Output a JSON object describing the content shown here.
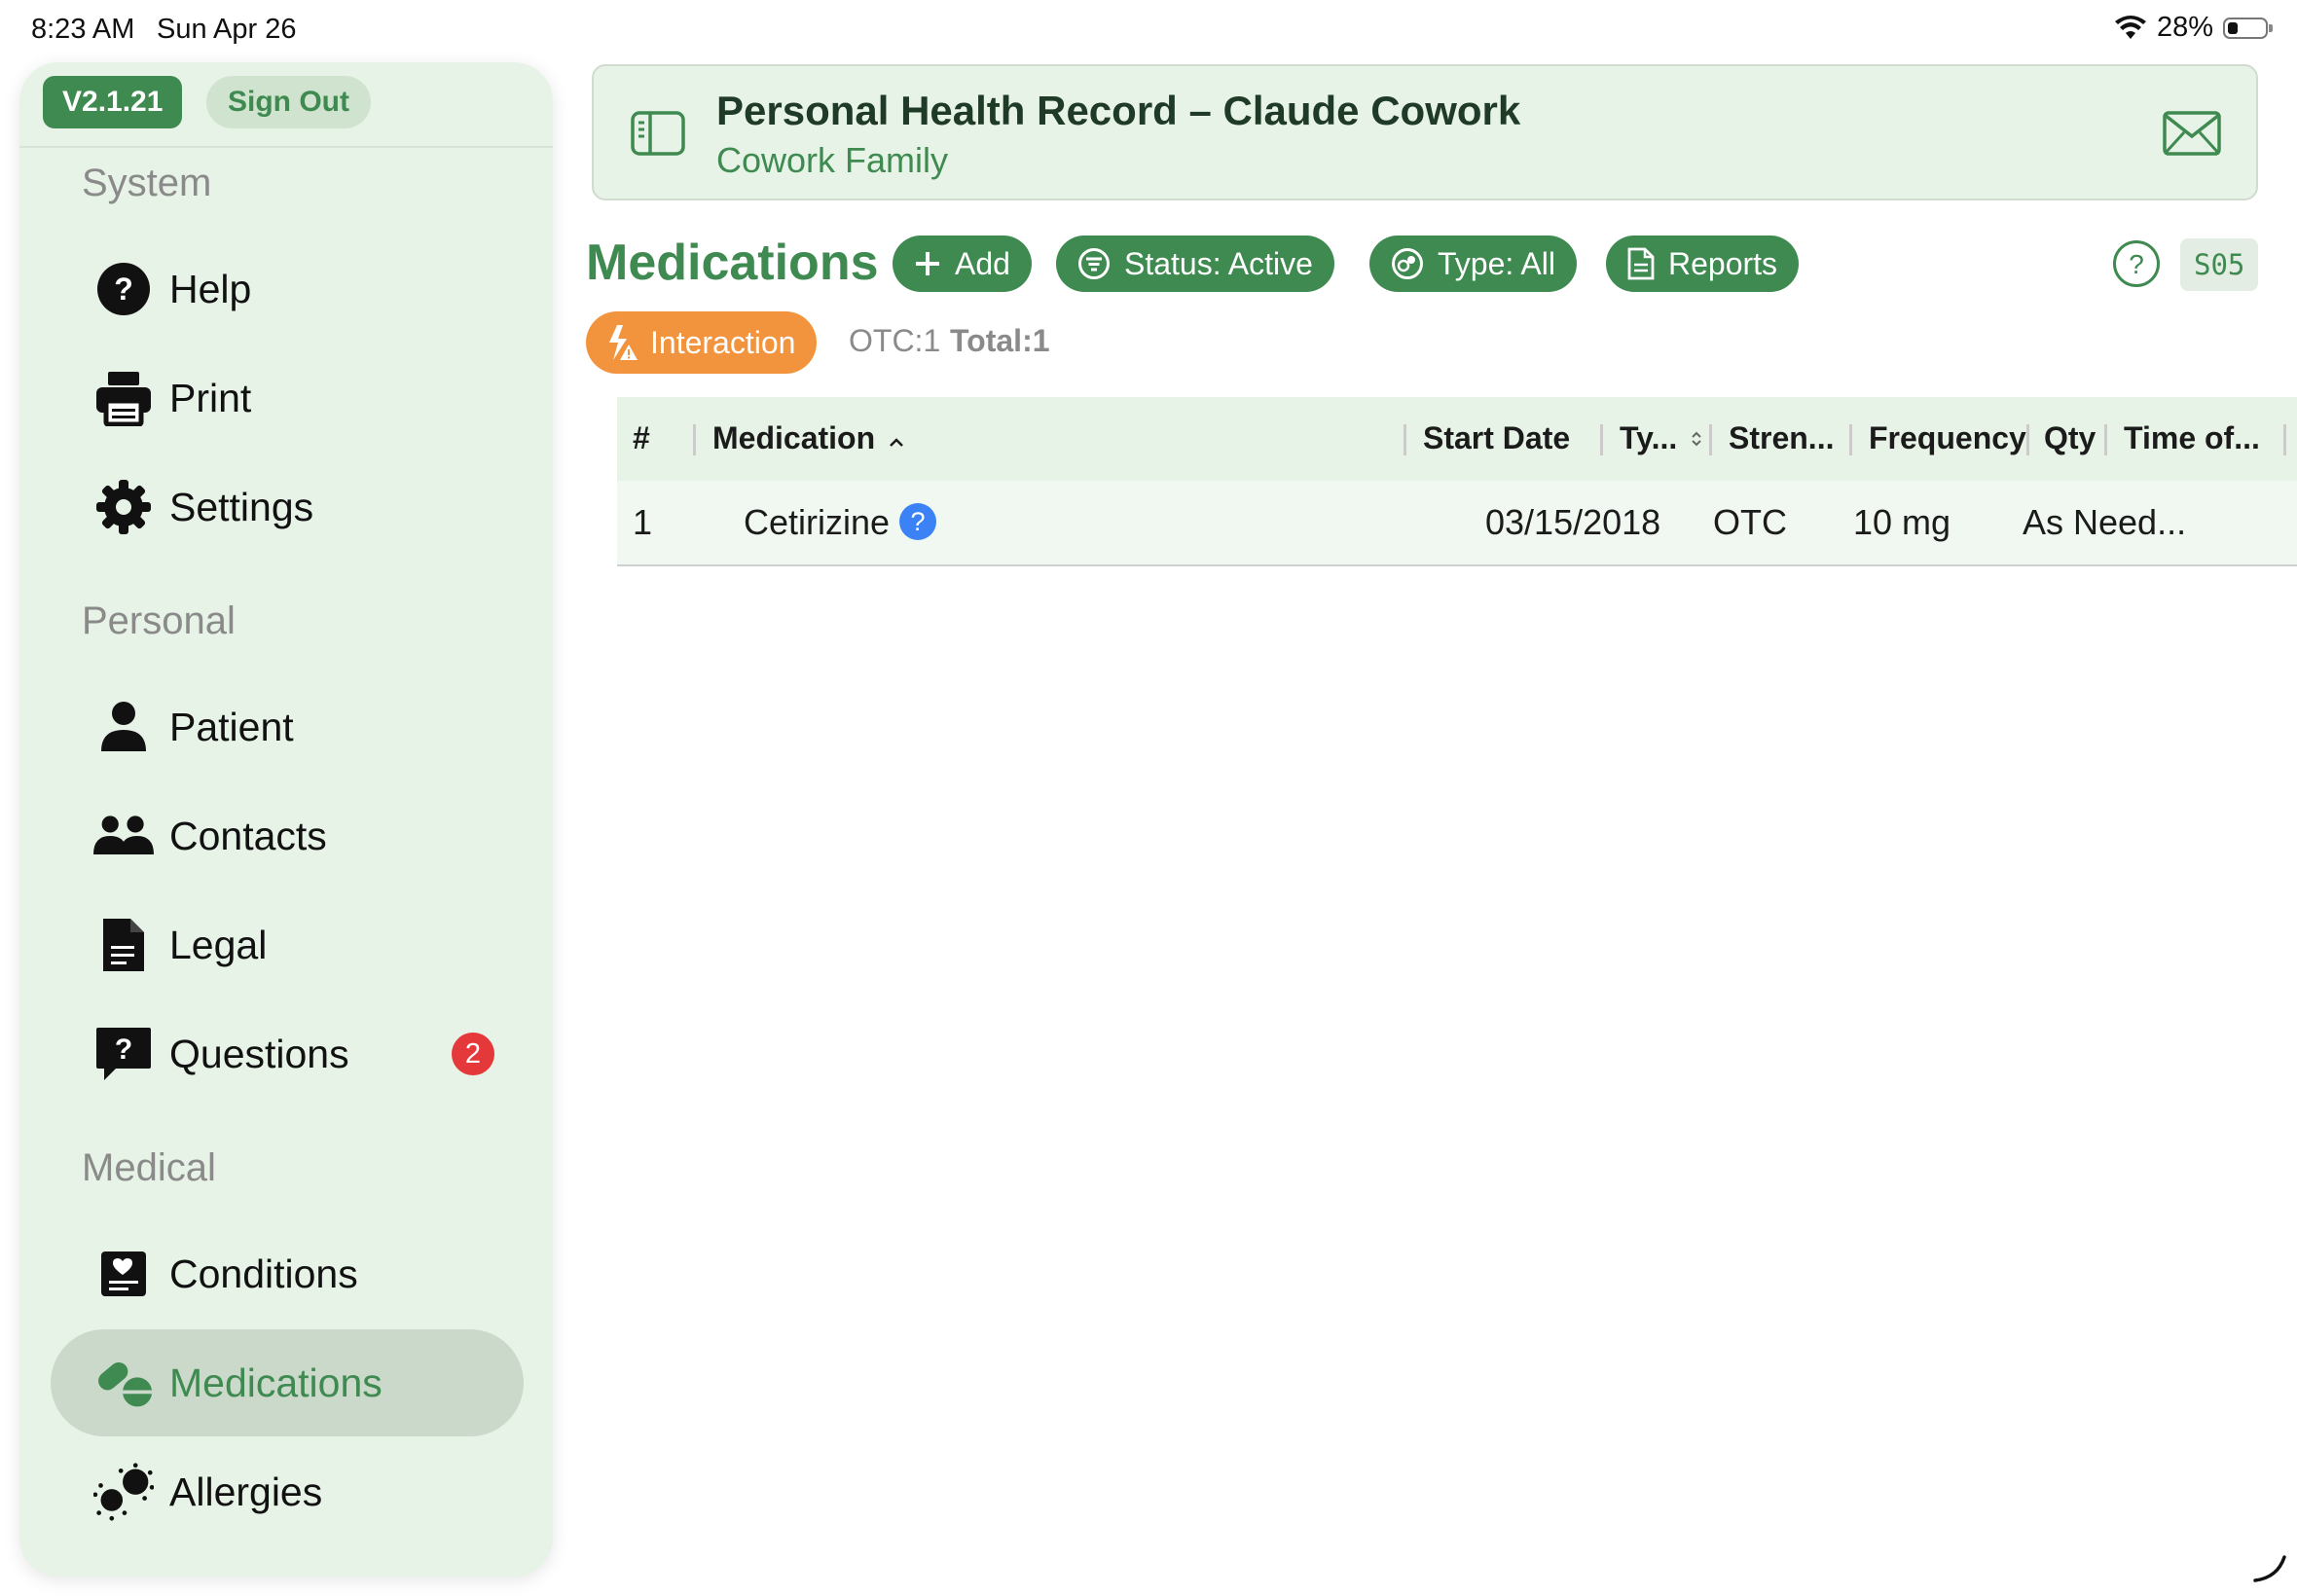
{
  "status_bar": {
    "time": "8:23 AM",
    "date": "Sun Apr 26",
    "battery": "28%"
  },
  "sidebar": {
    "version": "V2.1.21",
    "sign_out": "Sign Out",
    "sections": {
      "system": "System",
      "personal": "Personal",
      "medical": "Medical"
    },
    "items": {
      "help": "Help",
      "print": "Print",
      "settings": "Settings",
      "patient": "Patient",
      "contacts": "Contacts",
      "legal": "Legal",
      "questions": "Questions",
      "questions_badge": "2",
      "conditions": "Conditions",
      "medications": "Medications",
      "allergies": "Allergies"
    },
    "active_item": "Medications"
  },
  "header": {
    "title": "Personal Health Record – Claude Cowork",
    "subtitle": "Cowork Family"
  },
  "toolbar": {
    "page_title": "Medications",
    "add": "Add",
    "status": "Status: Active",
    "type": "Type: All",
    "reports": "Reports",
    "screen_code": "S05"
  },
  "summary": {
    "interaction": "Interaction",
    "otc_count": "OTC:1",
    "total": "Total:1"
  },
  "table": {
    "columns": {
      "num": "#",
      "medication": "Medication",
      "start_date": "Start Date",
      "type": "Ty...",
      "strength": "Stren...",
      "frequency": "Frequency",
      "qty": "Qty",
      "time_of": "Time of..."
    },
    "rows": [
      {
        "num": "1",
        "medication": "Cetirizine",
        "start_date": "03/15/2018",
        "type": "OTC",
        "strength": "10 mg",
        "frequency": "As Need..."
      }
    ]
  },
  "colors": {
    "brand_green": "#3f8a50",
    "sidebar_bg": "#e7f3e7",
    "interaction_orange": "#f2933d",
    "badge_red": "#e5383b",
    "info_blue": "#3b82f6"
  },
  "icons": {
    "help": "question-circle-icon",
    "print": "printer-icon",
    "settings": "gear-icon",
    "patient": "person-icon",
    "contacts": "people-icon",
    "legal": "document-icon",
    "questions": "question-bubble-icon",
    "conditions": "heart-clipboard-icon",
    "medications": "pills-icon",
    "allergies": "allergen-icon"
  }
}
